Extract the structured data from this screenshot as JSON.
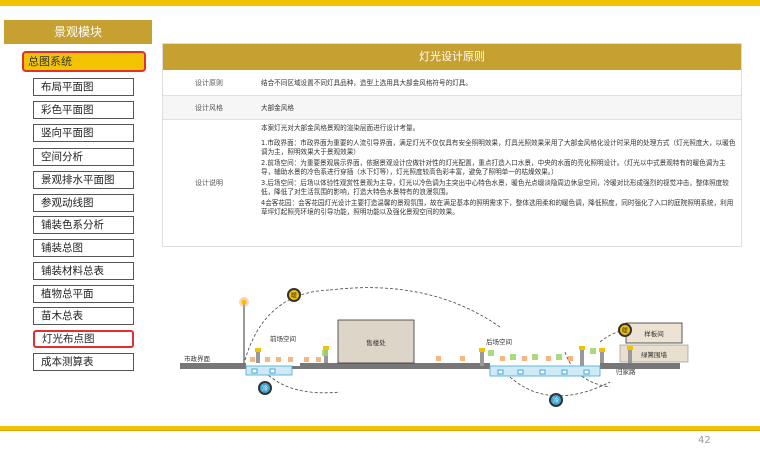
{
  "sidebar": {
    "title": "景观模块",
    "current": "总图系统",
    "items": [
      "布局平面图",
      "彩色平面图",
      "竖向平面图",
      "空间分析",
      "景观排水平面图",
      "参观动线图",
      "铺装色系分析",
      "铺装总图",
      "铺装材料总表",
      "植物总平面",
      "苗木总表",
      "灯光布点图",
      "成本测算表"
    ]
  },
  "table": {
    "header": "灯光设计原则",
    "rows": [
      {
        "label": "设计原则",
        "text": "结合不同区域设置不同灯具品种，造型上选用具大部金风格符号的灯具。"
      },
      {
        "label": "设计风格",
        "text": "大部金风格"
      },
      {
        "label": "设计说明",
        "paras": [
          "本案灯光对大部金风格景观的渲染层面进行设计考量。",
          "1.市政界面：市政界面为重要的人流引导界面，满足灯光不仅仅具有安全照明效果，灯具光照效果采用了大部金风格化设计时采用的处理方式（灯光照度大，以暖色调为主，照明效果大于景观效果）",
          "2.前场空间：为重要景观展示界面，依据景观设计应做针对性的灯光配置，重点打造入口水景，中央的水面的亮化照明设计。（灯光以中式景观特有的暖色调为主导，辅助水景的冷色系进行穿插（水下灯等），灯光照度较高色彩丰富，避免了照明单一的枯燥效果。）",
          "3.后场空间：后场以体验性观赏性景观为主导，灯光以冷色调为主突出中心特色水景，暖色光点缀淡隐周边休息空间，冷暖对比形成强烈的视觉冲击，整体照度较低，降低了对生活氛围的影响，打造大特色水景特有的浪漫氛围。",
          "4会客花园：会客花园灯光设计主要打造温馨的景观氛围，故在满足基本的照明需求下，整体选用柔和的暖色调，降低照度，同时强化了入口的庭院照明系统，利用草坪灯起照亮环境的引导功能，照明功能以及强化景观空间的效果。"
        ]
      }
    ]
  },
  "diagram": {
    "labels": {
      "street": "市政界面",
      "front": "前场空间",
      "sales": "售楼处",
      "back": "后场空间",
      "home": "归家路",
      "guest": "样板间",
      "wall": "绿篱围墙"
    },
    "warm_badge": "暖",
    "cool_badge": "冷",
    "colors": {
      "warm": "#f2c200",
      "cool": "#3fa9d6",
      "ground": "#666666",
      "glow": "#f4a460"
    }
  },
  "page_number": "42"
}
